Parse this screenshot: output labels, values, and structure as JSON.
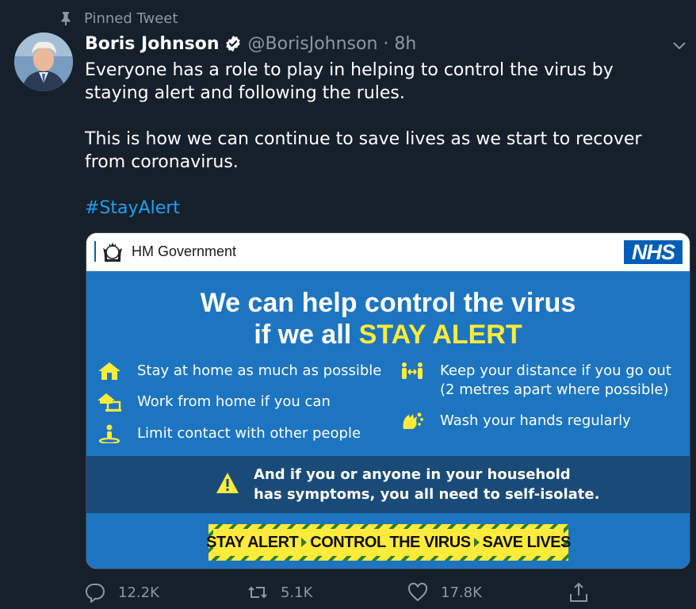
{
  "pinned": {
    "label": "Pinned Tweet"
  },
  "tweet": {
    "author_name": "Boris Johnson",
    "handle": "@BorisJohnson",
    "separator": "·",
    "time": "8h",
    "paragraphs": [
      "Everyone has a role to play in helping to control the virus by staying alert and following the rules.",
      "This is how we can continue to save lives as we start to recover from coronavirus."
    ],
    "hashtag": "#StayAlert"
  },
  "card": {
    "gov_label": "HM Government",
    "nhs_label": "NHS",
    "headline_line1": "We can help control the virus",
    "headline_line2_prefix": "if we all ",
    "headline_line2_highlight": "STAY ALERT",
    "left_items": [
      {
        "icon": "home-icon",
        "text": "Stay at home as much as possible"
      },
      {
        "icon": "work-from-home-icon",
        "text": "Work from home if you can"
      },
      {
        "icon": "person-icon",
        "text": "Limit contact with other people"
      }
    ],
    "right_items": [
      {
        "icon": "distance-icon",
        "line1": "Keep your distance if you go out",
        "line2": "(2 metres apart where possible)"
      },
      {
        "icon": "wash-hands-icon",
        "line1": "Wash your hands regularly"
      }
    ],
    "warning_line1": "And if you or anyone in your household",
    "warning_line2": "has symptoms, you all need to self-isolate.",
    "banner": [
      "STAY ALERT",
      "CONTROL THE VIRUS",
      "SAVE LIVES"
    ]
  },
  "actions": {
    "reply_count": "12.2K",
    "retweet_count": "5.1K",
    "like_count": "17.8K"
  },
  "colors": {
    "background": "#15202b",
    "muted": "#8899a6",
    "link": "#1da1f2",
    "nhs_blue": "#1d75c1",
    "alert_yellow": "#ffeb3b",
    "banner_green": "#2e7d32"
  }
}
